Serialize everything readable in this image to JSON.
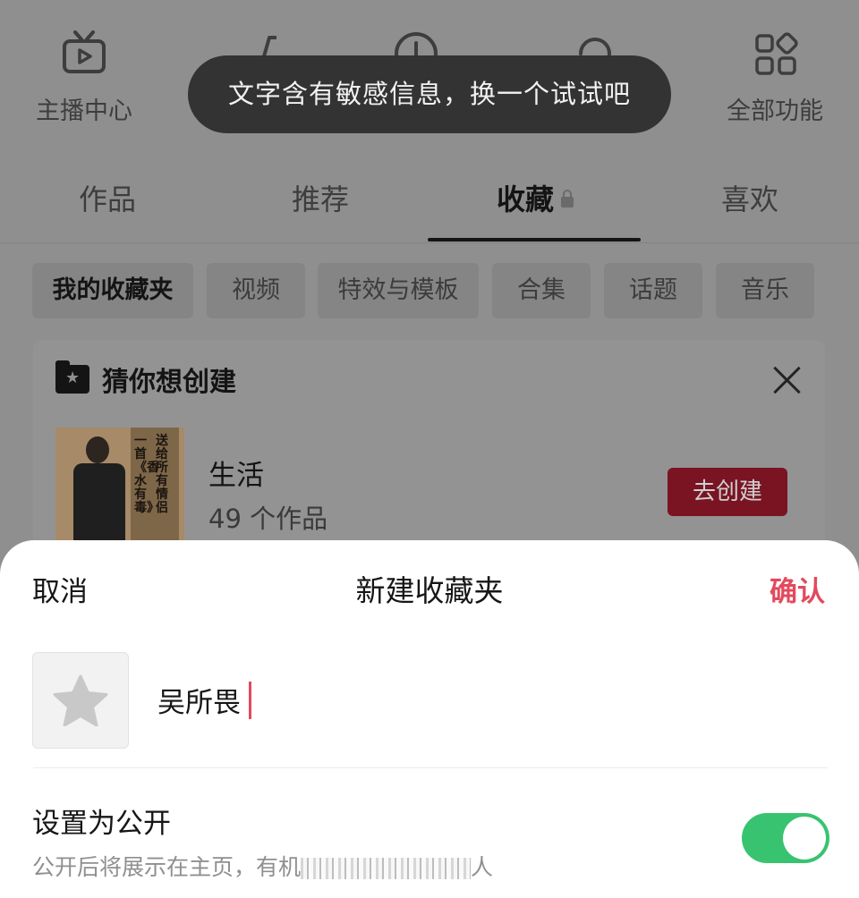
{
  "quick_actions": [
    {
      "label": "主播中心",
      "icon": "tv-icon"
    },
    {
      "label": "",
      "icon": "cart-icon"
    },
    {
      "label": "",
      "icon": "clock-icon"
    },
    {
      "label": "",
      "icon": "refresh-icon"
    },
    {
      "label": "全部功能",
      "icon": "grid-icon"
    }
  ],
  "toast": {
    "text": "文字含有敏感信息，换一个试试吧"
  },
  "tabs": [
    {
      "label": "作品"
    },
    {
      "label": "推荐"
    },
    {
      "label": "收藏",
      "locked": true,
      "active": true
    },
    {
      "label": "喜欢"
    }
  ],
  "chips": [
    {
      "label": "我的收藏夹",
      "active": true
    },
    {
      "label": "视频"
    },
    {
      "label": "特效与模板"
    },
    {
      "label": "合集"
    },
    {
      "label": "话题"
    },
    {
      "label": "音乐"
    }
  ],
  "suggestion": {
    "title": "猜你想创建",
    "thumb_text": [
      "一首《香水有毒》",
      "送给所有情侣"
    ],
    "folder_name": "生活",
    "count": "49 个作品",
    "create_button": "去创建"
  },
  "sheet": {
    "cancel": "取消",
    "title": "新建收藏夹",
    "confirm": "确认",
    "name_value": "吴所畏",
    "public_label": "设置为公开",
    "public_desc_start": "公开后将展示在主页，有机",
    "public_desc_end": "人",
    "public_enabled": true
  },
  "colors": {
    "accent": "#e24a5e",
    "toggle_on": "#38c370",
    "toast_bg": "#333334",
    "create_btn": "#7a1423"
  }
}
